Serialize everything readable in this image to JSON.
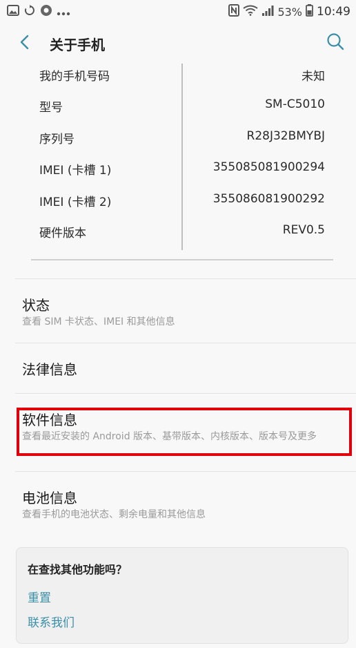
{
  "status_bar": {
    "battery_percent": "53%",
    "time": "10:49",
    "icons": [
      "image-icon",
      "sync-icon",
      "settings-app-icon",
      "more-icon",
      "nfc-icon",
      "wifi-icon",
      "signal-icon",
      "battery-icon"
    ]
  },
  "app_bar": {
    "title": "关于手机",
    "accent": "#3a8fa8"
  },
  "info": {
    "rows": [
      {
        "label": "我的手机号码",
        "value": "未知"
      },
      {
        "label": "型号",
        "value": "SM-C5010"
      },
      {
        "label": "序列号",
        "value": "R28J32BMYBJ"
      },
      {
        "label": "IMEI (卡槽 1)",
        "value": "355085081900294"
      },
      {
        "label": "IMEI (卡槽 2)",
        "value": "355086081900292"
      },
      {
        "label": "硬件版本",
        "value": "REV0.5"
      }
    ]
  },
  "menu": {
    "status": {
      "title": "状态",
      "subtitle": "查看 SIM 卡状态、IMEI 和其他信息"
    },
    "legal": {
      "title": "法律信息"
    },
    "software": {
      "title": "软件信息",
      "subtitle": "查看最近安装的 Android 版本、基带版本、内核版本、版本号及更多"
    },
    "battery": {
      "title": "电池信息",
      "subtitle": "查看手机的电池状态、剩余电量和其他信息"
    }
  },
  "card": {
    "title": "在查找其他功能吗？",
    "reset_label": "重置",
    "contact_label": "联系我们"
  },
  "colors": {
    "highlight": "#e0000c",
    "link": "#3a8fa8"
  }
}
